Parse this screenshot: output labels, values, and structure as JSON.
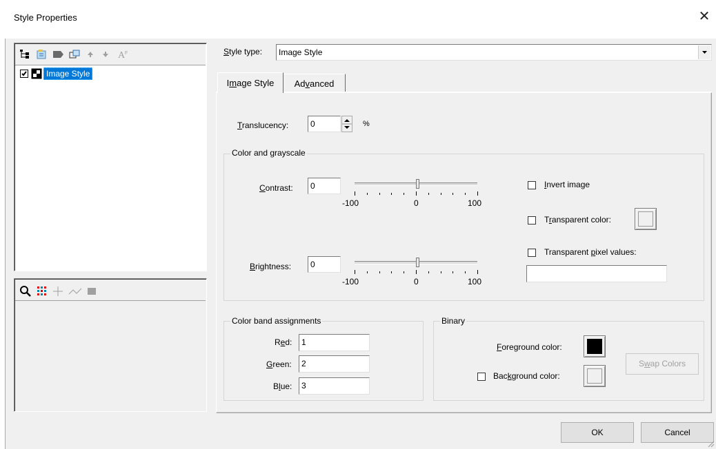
{
  "window": {
    "title": "Style Properties"
  },
  "tree": {
    "item_label": "Image Style",
    "checked": true,
    "toolbar_icons": [
      "tree-structure-icon",
      "add-style-icon",
      "remove-style-icon",
      "copy-style-icon",
      "move-up-icon",
      "move-down-icon",
      "font-style-icon"
    ]
  },
  "preview_toolbar": {
    "icons": [
      "zoom-icon",
      "grid-icon",
      "crosshair-icon",
      "line-icon",
      "fill-icon"
    ]
  },
  "style_type": {
    "label_u": "S",
    "label_rest": "tyle type:",
    "value": "Image Style"
  },
  "tabs": [
    {
      "pre": "I",
      "u": "m",
      "post": "age Style",
      "active": true
    },
    {
      "pre": "Ad",
      "u": "v",
      "post": "anced",
      "active": false
    }
  ],
  "translucency": {
    "u": "T",
    "rest": "ranslucency:",
    "value": "0",
    "unit": "%"
  },
  "color_group": {
    "title": "Color and grayscale",
    "contrast": {
      "u": "C",
      "rest": "ontrast:",
      "value": "0",
      "ticks": [
        "-100",
        "0",
        "100"
      ]
    },
    "brightness": {
      "u": "B",
      "rest": "rightness:",
      "value": "0",
      "ticks": [
        "-100",
        "0",
        "100"
      ]
    },
    "invert": {
      "u": "I",
      "rest": "nvert image",
      "checked": false
    },
    "transparent_color": {
      "pre": "T",
      "u": "r",
      "post": "ansparent color:",
      "checked": false
    },
    "transparent_pixels": {
      "pre": "Transparent ",
      "u": "p",
      "post": "ixel values:",
      "checked": false,
      "value": ""
    }
  },
  "band_group": {
    "title": "Color band assignments",
    "red": {
      "pre": "R",
      "u": "e",
      "post": "d:",
      "value": "1"
    },
    "green": {
      "pre": "",
      "u": "G",
      "post": "reen:",
      "value": "2"
    },
    "blue": {
      "pre": "B",
      "u": "l",
      "post": "ue:",
      "value": "3"
    }
  },
  "binary_group": {
    "title": "Binary",
    "foreground": {
      "u": "F",
      "rest": "oreground color:",
      "color": "#000000"
    },
    "background": {
      "pre": "Bac",
      "u": "k",
      "post": "ground color:",
      "checked": false
    },
    "swap": {
      "pre": "S",
      "u": "w",
      "post": "ap Colors"
    }
  },
  "buttons": {
    "ok": "OK",
    "cancel": "Cancel"
  },
  "colors": {
    "selection": "#0078d7",
    "dialog_bg": "#f0f0f0"
  }
}
